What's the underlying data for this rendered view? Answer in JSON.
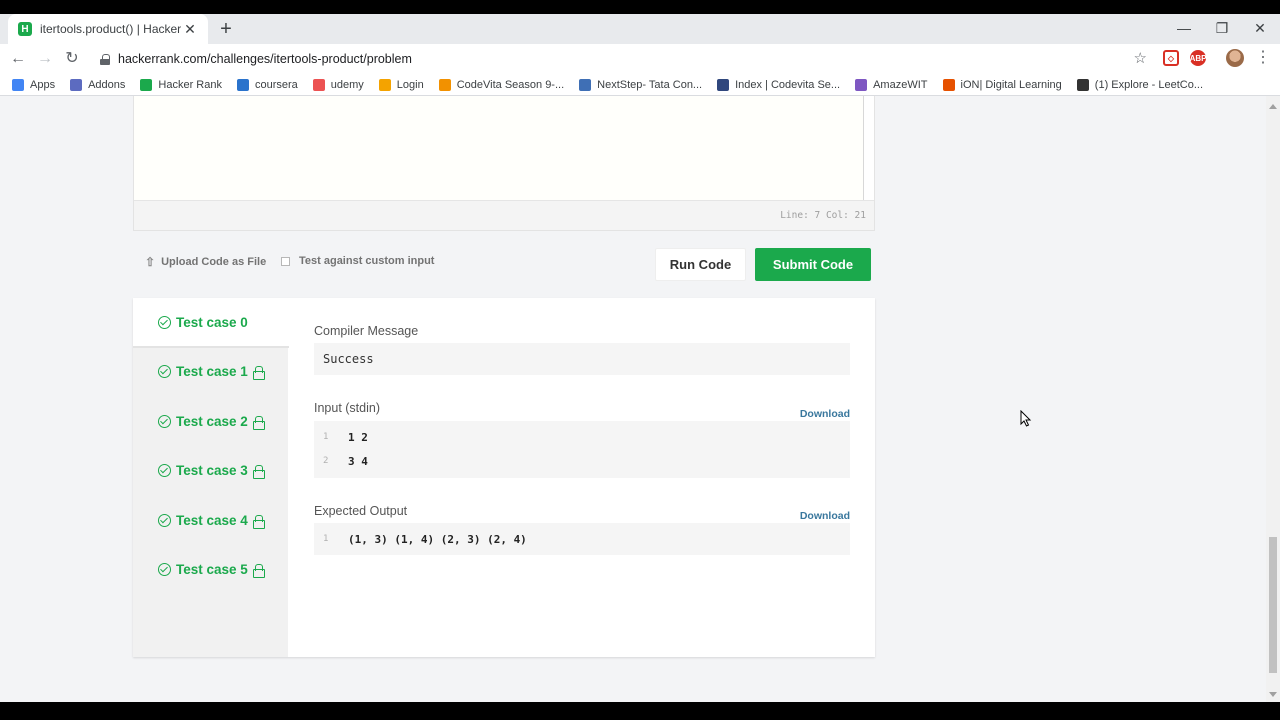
{
  "browser": {
    "tab_title": "itertools.product() | HackerRank",
    "tab_favicon": "H",
    "url_host": "hackerrank.com",
    "url_path": "/challenges/itertools-product/problem",
    "bookmarks": [
      {
        "label": "Apps",
        "icon": "apps-icon",
        "color": "#4285f4"
      },
      {
        "label": "Addons",
        "icon": "addons-icon",
        "color": "#5c6bc0"
      },
      {
        "label": "Hacker Rank",
        "icon": "hackerrank-icon",
        "color": "#1ba94c"
      },
      {
        "label": "coursera",
        "icon": "coursera-icon",
        "color": "#2a73cc"
      },
      {
        "label": "udemy",
        "icon": "udemy-icon",
        "color": "#ec5252"
      },
      {
        "label": "Login",
        "icon": "login-icon",
        "color": "#f4a300"
      },
      {
        "label": "CodeVita Season 9-...",
        "icon": "codevita-icon",
        "color": "#f29100"
      },
      {
        "label": "NextStep- Tata Con...",
        "icon": "nextstep-icon",
        "color": "#3f6fb5"
      },
      {
        "label": "Index | Codevita Se...",
        "icon": "index-icon",
        "color": "#30477d"
      },
      {
        "label": "AmazeWIT",
        "icon": "amazewit-icon",
        "color": "#7e57c2"
      },
      {
        "label": "iON| Digital Learning",
        "icon": "ion-icon",
        "color": "#e65100"
      },
      {
        "label": "(1) Explore - LeetCo...",
        "icon": "leetcode-icon",
        "color": "#333333"
      }
    ]
  },
  "editor": {
    "line_col": "Line: 7 Col: 21"
  },
  "actions": {
    "upload_label": "Upload Code as File",
    "custom_input_label": "Test against custom input",
    "run_label": "Run Code",
    "submit_label": "Submit Code"
  },
  "test_cases": [
    {
      "label": "Test case 0",
      "locked": false,
      "active": true
    },
    {
      "label": "Test case 1",
      "locked": true,
      "active": false
    },
    {
      "label": "Test case 2",
      "locked": true,
      "active": false
    },
    {
      "label": "Test case 3",
      "locked": true,
      "active": false
    },
    {
      "label": "Test case 4",
      "locked": true,
      "active": false
    },
    {
      "label": "Test case 5",
      "locked": true,
      "active": false
    }
  ],
  "result": {
    "compiler_label": "Compiler Message",
    "compiler_message": "Success",
    "input_label": "Input (stdin)",
    "input_download": "Download",
    "input_lines": [
      {
        "n": "1",
        "text": "1 2"
      },
      {
        "n": "2",
        "text": "3 4"
      }
    ],
    "expected_label": "Expected Output",
    "expected_download": "Download",
    "expected_lines": [
      {
        "n": "1",
        "text": "(1, 3) (1, 4) (2, 3) (2, 4)"
      }
    ]
  },
  "colors": {
    "accent_green": "#1ba94c",
    "link_blue": "#39779d"
  }
}
